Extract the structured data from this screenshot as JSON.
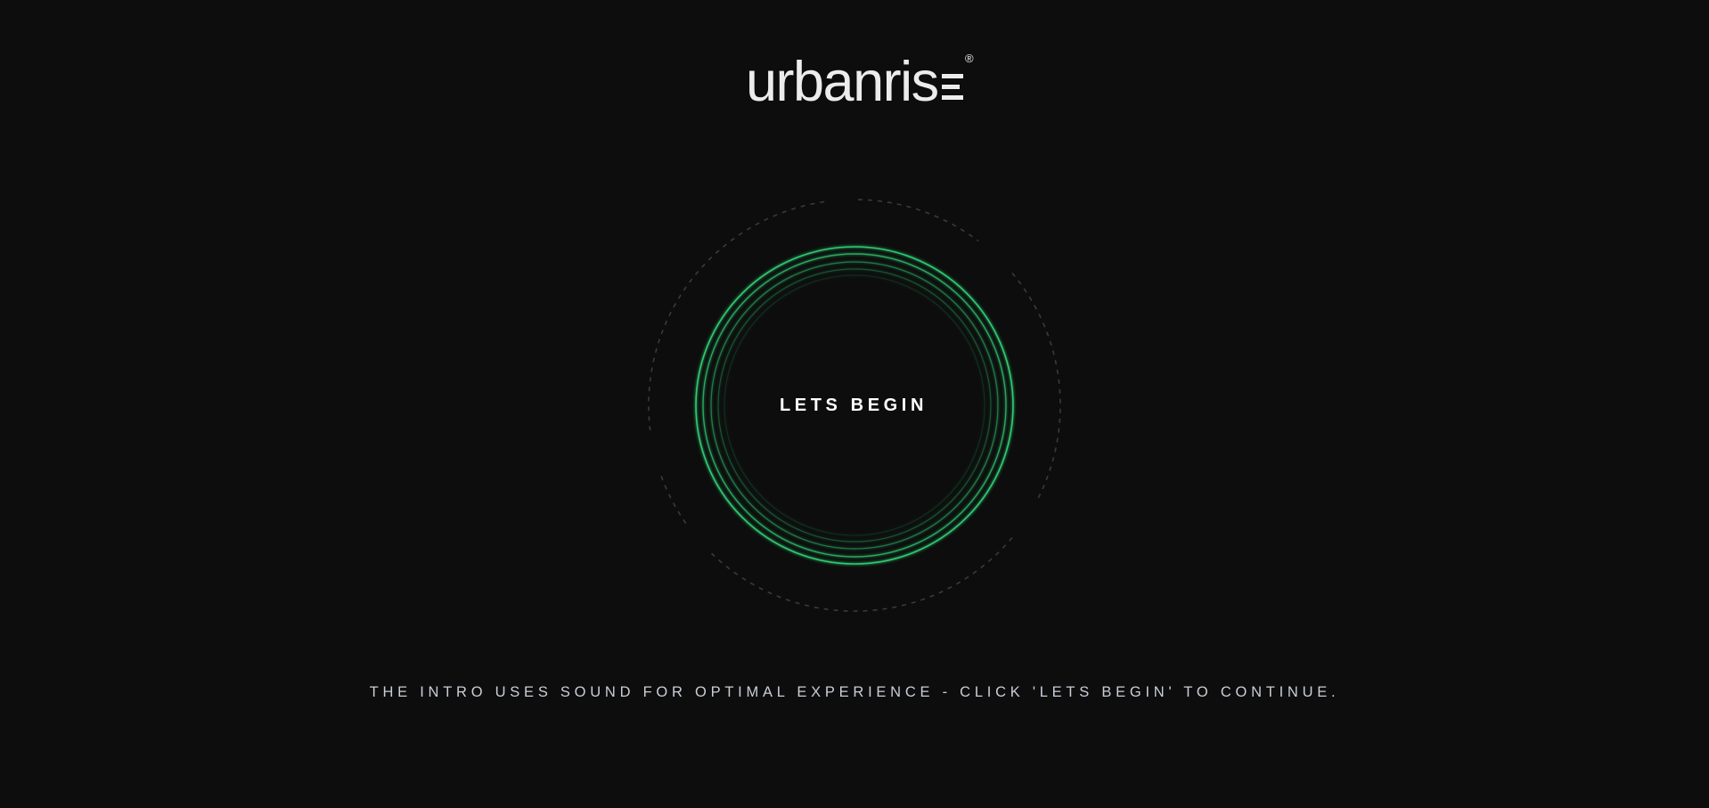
{
  "brand": {
    "name": "urbanris",
    "registered_mark": "®"
  },
  "button": {
    "label": "LETS BEGIN"
  },
  "notice": "THE INTRO USES SOUND FOR OPTIMAL EXPERIENCE - CLICK 'LETS BEGIN' TO CONTINUE.",
  "colors": {
    "background": "#0d0d0d",
    "accent": "#2ecc71",
    "text": "#ffffff",
    "notice_text": "#c9ced6",
    "dashed_ring": "#3a3a3a"
  }
}
